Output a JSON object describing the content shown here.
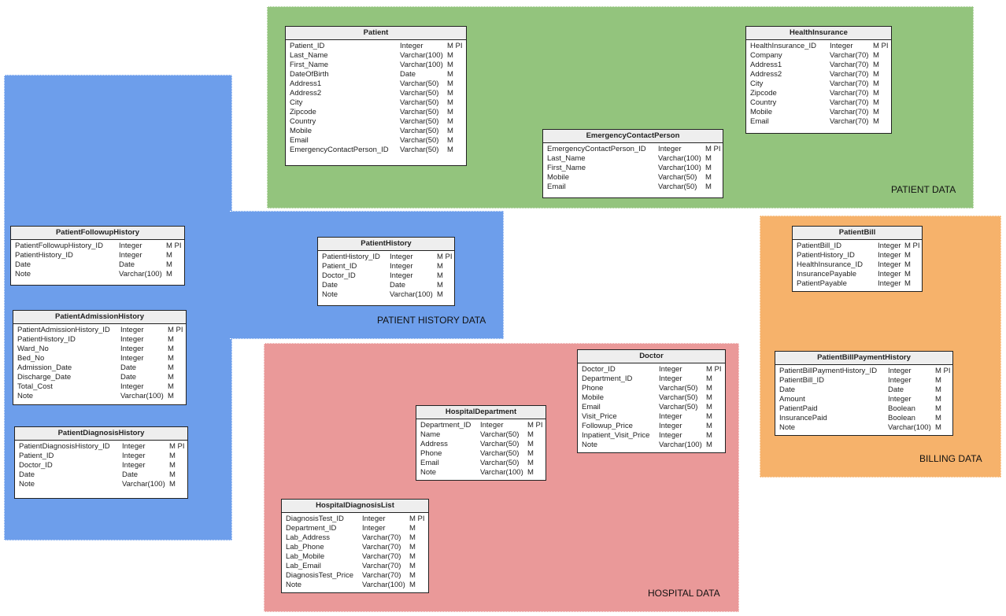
{
  "regions": [
    {
      "id": "patient-data",
      "label": "PATIENT DATA",
      "color": "#93c47d"
    },
    {
      "id": "patient-history-data",
      "label": "PATIENT HISTORY DATA",
      "color": "#6d9eeb"
    },
    {
      "id": "hospital-data",
      "label": "HOSPITAL DATA",
      "color": "#ea9999"
    },
    {
      "id": "billing-data",
      "label": "BILLING DATA",
      "color": "#f6b26b"
    }
  ],
  "tables": [
    {
      "name": "Patient",
      "columns": [
        [
          "Patient_ID",
          "Integer",
          "M PI"
        ],
        [
          "Last_Name",
          "Varchar(100)",
          "M"
        ],
        [
          "First_Name",
          "Varchar(100)",
          "M"
        ],
        [
          "DateOfBirth",
          "Date",
          "M"
        ],
        [
          "Address1",
          "Varchar(50)",
          "M"
        ],
        [
          "Address2",
          "Varchar(50)",
          "M"
        ],
        [
          "City",
          "Varchar(50)",
          "M"
        ],
        [
          "Zipcode",
          "Varchar(50)",
          "M"
        ],
        [
          "Country",
          "Varchar(50)",
          "M"
        ],
        [
          "Mobile",
          "Varchar(50)",
          "M"
        ],
        [
          "Email",
          "Varchar(50)",
          "M"
        ],
        [
          "EmergencyContactPerson_ID",
          "Varchar(50)",
          "M"
        ]
      ]
    },
    {
      "name": "HealthInsurance",
      "columns": [
        [
          "HealthInsurance_ID",
          "Integer",
          "M PI"
        ],
        [
          "Company",
          "Varchar(70)",
          "M"
        ],
        [
          "Address1",
          "Varchar(70)",
          "M"
        ],
        [
          "Address2",
          "Varchar(70)",
          "M"
        ],
        [
          "City",
          "Varchar(70)",
          "M"
        ],
        [
          "Zipcode",
          "Varchar(70)",
          "M"
        ],
        [
          "Country",
          "Varchar(70)",
          "M"
        ],
        [
          "Mobile",
          "Varchar(70)",
          "M"
        ],
        [
          "Email",
          "Varchar(70)",
          "M"
        ]
      ]
    },
    {
      "name": "EmergencyContactPerson",
      "columns": [
        [
          "EmergencyContactPerson_ID",
          "Integer",
          "M PI"
        ],
        [
          "Last_Name",
          "Varchar(100)",
          "M"
        ],
        [
          "First_Name",
          "Varchar(100)",
          "M"
        ],
        [
          "Mobile",
          "Varchar(50)",
          "M"
        ],
        [
          "Email",
          "Varchar(50)",
          "M"
        ]
      ]
    },
    {
      "name": "PatientFollowupHistory",
      "columns": [
        [
          "PatientFollowupHistory_ID",
          "Integer",
          "M PI"
        ],
        [
          "PatientHistory_ID",
          "Integer",
          "M"
        ],
        [
          "Date",
          "Date",
          "M"
        ],
        [
          "Note",
          "Varchar(100)",
          "M"
        ]
      ]
    },
    {
      "name": "PatientHistory",
      "columns": [
        [
          "PatientHistory_ID",
          "Integer",
          "M PI"
        ],
        [
          "Patient_ID",
          "Integer",
          "M"
        ],
        [
          "Doctor_ID",
          "Integer",
          "M"
        ],
        [
          "Date",
          "Date",
          "M"
        ],
        [
          "Note",
          "Varchar(100)",
          "M"
        ]
      ]
    },
    {
      "name": "PatientAdmissionHistory",
      "columns": [
        [
          "PatientAdmissionHistory_ID",
          "Integer",
          "M PI"
        ],
        [
          "PatientHistory_ID",
          "Integer",
          "M"
        ],
        [
          "Ward_No",
          "Integer",
          "M"
        ],
        [
          "Bed_No",
          "Integer",
          "M"
        ],
        [
          "Admission_Date",
          "Date",
          "M"
        ],
        [
          "Discharge_Date",
          "Date",
          "M"
        ],
        [
          "Total_Cost",
          "Integer",
          "M"
        ],
        [
          "Note",
          "Varchar(100)",
          "M"
        ]
      ]
    },
    {
      "name": "PatientDiagnosisHistory",
      "columns": [
        [
          "PatientDiagnosisHistory_ID",
          "Integer",
          "M PI"
        ],
        [
          "Patient_ID",
          "Integer",
          "M"
        ],
        [
          "Doctor_ID",
          "Integer",
          "M"
        ],
        [
          "Date",
          "Date",
          "M"
        ],
        [
          "Note",
          "Varchar(100)",
          "M"
        ]
      ]
    },
    {
      "name": "PatientBill",
      "columns": [
        [
          "PatientBill_ID",
          "Integer",
          "M PI"
        ],
        [
          "PatientHistory_ID",
          "Integer",
          "M"
        ],
        [
          "HealthInsurance_ID",
          "Integer",
          "M"
        ],
        [
          "InsurancePayable",
          "Integer",
          "M"
        ],
        [
          "PatientPayable",
          "Integer",
          "M"
        ]
      ]
    },
    {
      "name": "PatientBillPaymentHistory",
      "columns": [
        [
          "PatientBillPaymentHistory_ID",
          "Integer",
          "M PI"
        ],
        [
          "PatientBill_ID",
          "Integer",
          "M"
        ],
        [
          "Date",
          "Date",
          "M"
        ],
        [
          "Amount",
          "Integer",
          "M"
        ],
        [
          "PatientPaid",
          "Boolean",
          "M"
        ],
        [
          "InsurancePaid",
          "Boolean",
          "M"
        ],
        [
          "Note",
          "Varchar(100)",
          "M"
        ]
      ]
    },
    {
      "name": "Doctor",
      "columns": [
        [
          "Doctor_ID",
          "Integer",
          "M PI"
        ],
        [
          "Department_ID",
          "Integer",
          "M"
        ],
        [
          "Phone",
          "Varchar(50)",
          "M"
        ],
        [
          "Mobile",
          "Varchar(50)",
          "M"
        ],
        [
          "Email",
          "Varchar(50)",
          "M"
        ],
        [
          "Visit_Price",
          "Integer",
          "M"
        ],
        [
          "Followup_Price",
          "Integer",
          "M"
        ],
        [
          "Inpatient_Visit_Price",
          "Integer",
          "M"
        ],
        [
          "Note",
          "Varchar(100)",
          "M"
        ]
      ]
    },
    {
      "name": "HospitalDepartment",
      "columns": [
        [
          "Department_ID",
          "Integer",
          "M PI"
        ],
        [
          "Name",
          "Varchar(50)",
          "M"
        ],
        [
          "Address",
          "Varchar(50)",
          "M"
        ],
        [
          "Phone",
          "Varchar(50)",
          "M"
        ],
        [
          "Email",
          "Varchar(50)",
          "M"
        ],
        [
          "Note",
          "Varchar(100)",
          "M"
        ]
      ]
    },
    {
      "name": "HospitalDiagnosisList",
      "columns": [
        [
          "DiagnosisTest_ID",
          "Integer",
          "M PI"
        ],
        [
          "Department_ID",
          "Integer",
          "M"
        ],
        [
          "Lab_Address",
          "Varchar(70)",
          "M"
        ],
        [
          "Lab_Phone",
          "Varchar(70)",
          "M"
        ],
        [
          "Lab_Mobile",
          "Varchar(70)",
          "M"
        ],
        [
          "Lab_Email",
          "Varchar(70)",
          "M"
        ],
        [
          "DiagnosisTest_Price",
          "Varchar(70)",
          "M"
        ],
        [
          "Note",
          "Varchar(100)",
          "M"
        ]
      ]
    }
  ]
}
